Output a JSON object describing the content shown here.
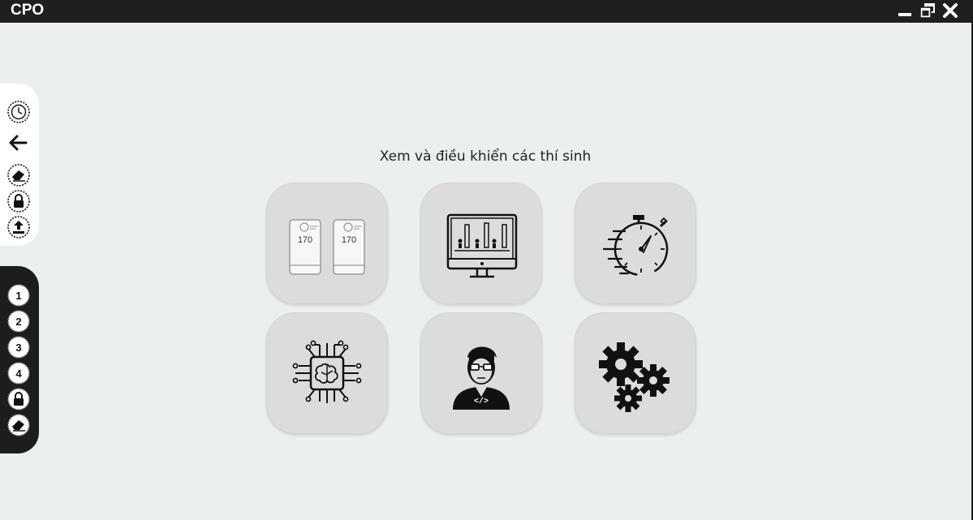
{
  "window": {
    "title": "CPO",
    "controls": [
      "minimize-icon",
      "restore-icon",
      "close-icon"
    ]
  },
  "sidebar_top": {
    "icons": [
      "clock-icon",
      "arrow-left-icon",
      "eraser-icon",
      "lock-icon",
      "upload-icon"
    ]
  },
  "sidebar_bottom": {
    "items": [
      {
        "label": "1"
      },
      {
        "label": "2"
      },
      {
        "label": "3"
      },
      {
        "label": "4"
      }
    ],
    "icons": [
      "lock-icon",
      "eraser-icon"
    ]
  },
  "main": {
    "heading": "Xem và điều khiển các thí sinh",
    "tiles": [
      {
        "icon": "contestant-cards-icon",
        "card_labels": [
          "170",
          "170"
        ]
      },
      {
        "icon": "monitor-chart-icon"
      },
      {
        "icon": "stopwatch-icon"
      },
      {
        "icon": "ai-chip-brain-icon"
      },
      {
        "icon": "programmer-icon",
        "code_label": "</>"
      },
      {
        "icon": "gears-icon"
      }
    ]
  },
  "colors": {
    "titlebar": "#1f1f1f",
    "background": "#eceff0",
    "tile": "#dcdcdc",
    "sidebar_bottom": "#1d1d1d"
  }
}
